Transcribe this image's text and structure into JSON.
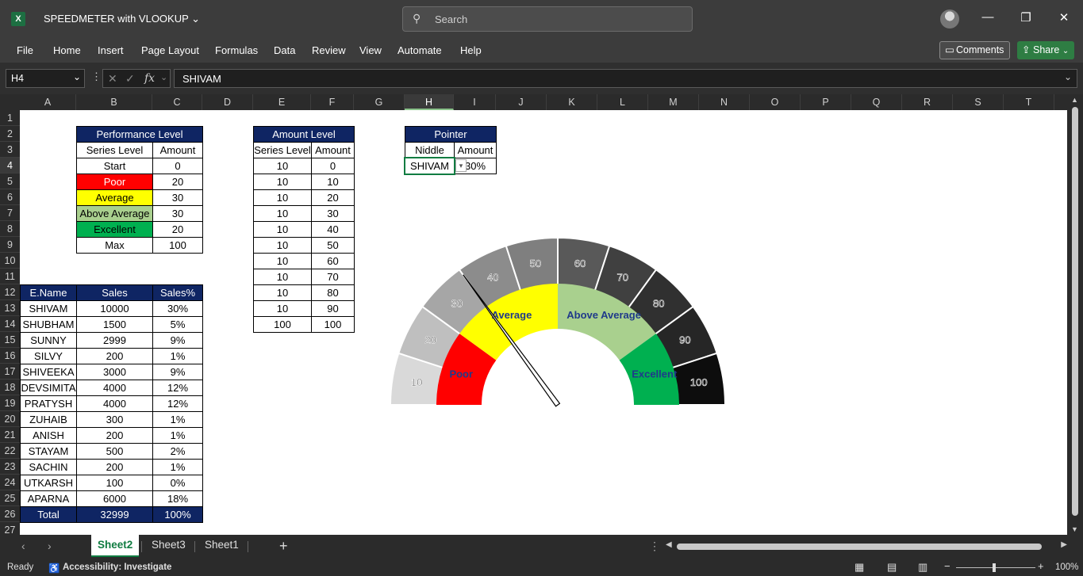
{
  "titlebar": {
    "app_icon": "X",
    "file_title": "SPEEDMETER with VLOOKUP",
    "search_placeholder": "Search"
  },
  "menu": {
    "tabs": [
      "File",
      "Home",
      "Insert",
      "Page Layout",
      "Formulas",
      "Data",
      "Review",
      "View",
      "Automate",
      "Help"
    ],
    "comments_label": "Comments",
    "share_label": "Share"
  },
  "formula_bar": {
    "name_box": "H4",
    "fx_label": "fx",
    "value": "SHIVAM"
  },
  "columns": [
    "A",
    "B",
    "C",
    "D",
    "E",
    "F",
    "G",
    "H",
    "I",
    "J",
    "K",
    "L",
    "M",
    "N",
    "O",
    "P",
    "Q",
    "R",
    "S",
    "T"
  ],
  "rows": [
    "1",
    "2",
    "3",
    "4",
    "5",
    "6",
    "7",
    "8",
    "9",
    "10",
    "11",
    "12",
    "13",
    "14",
    "15",
    "16",
    "17",
    "18",
    "19",
    "20",
    "21",
    "22",
    "23",
    "24",
    "25",
    "26",
    "27"
  ],
  "performance_table": {
    "title": "Performance Level",
    "headers": [
      "Series Level",
      "Amount"
    ],
    "rows": [
      {
        "level": "Start",
        "amount": "0",
        "color": "#ffffff",
        "text_color": "#000000"
      },
      {
        "level": "Poor",
        "amount": "20",
        "color": "#ff0000",
        "text_color": "#ffffff"
      },
      {
        "level": "Average",
        "amount": "30",
        "color": "#ffff00",
        "text_color": "#000000"
      },
      {
        "level": "Above Average",
        "amount": "30",
        "color": "#a9d08e",
        "text_color": "#000000"
      },
      {
        "level": "Excellent",
        "amount": "20",
        "color": "#00b050",
        "text_color": "#000000"
      },
      {
        "level": "Max",
        "amount": "100",
        "color": "#ffffff",
        "text_color": "#000000"
      }
    ]
  },
  "amount_table": {
    "title": "Amount Level",
    "headers": [
      "Series Level",
      "Amount"
    ],
    "rows": [
      [
        "10",
        "0"
      ],
      [
        "10",
        "10"
      ],
      [
        "10",
        "20"
      ],
      [
        "10",
        "30"
      ],
      [
        "10",
        "40"
      ],
      [
        "10",
        "50"
      ],
      [
        "10",
        "60"
      ],
      [
        "10",
        "70"
      ],
      [
        "10",
        "80"
      ],
      [
        "10",
        "90"
      ],
      [
        "100",
        "100"
      ]
    ]
  },
  "pointer_table": {
    "title": "Pointer",
    "headers": [
      "Niddle",
      "Amount"
    ],
    "name": "SHIVAM",
    "amount": "30%"
  },
  "sales_table": {
    "headers": [
      "E.Name",
      "Sales",
      "Sales%"
    ],
    "rows": [
      [
        "SHIVAM",
        "10000",
        "30%"
      ],
      [
        "SHUBHAM",
        "1500",
        "5%"
      ],
      [
        "SUNNY",
        "2999",
        "9%"
      ],
      [
        "SILVY",
        "200",
        "1%"
      ],
      [
        "SHIVEEKA",
        "3000",
        "9%"
      ],
      [
        "DEVSIMITA",
        "4000",
        "12%"
      ],
      [
        "PRATYSH",
        "4000",
        "12%"
      ],
      [
        "ZUHAIB",
        "300",
        "1%"
      ],
      [
        "ANISH",
        "200",
        "1%"
      ],
      [
        "STAYAM",
        "500",
        "2%"
      ],
      [
        "SACHIN",
        "200",
        "1%"
      ],
      [
        "UTKARSH",
        "100",
        "0%"
      ],
      [
        "APARNA",
        "6000",
        "18%"
      ]
    ],
    "total": [
      "Total",
      "32999",
      "100%"
    ]
  },
  "chart_data": {
    "type": "pie",
    "outer_ring": {
      "labels": [
        "10",
        "20",
        "30",
        "40",
        "50",
        "60",
        "70",
        "80",
        "90",
        "100"
      ],
      "values": [
        10,
        10,
        10,
        10,
        10,
        10,
        10,
        10,
        10,
        10
      ],
      "colors": [
        "#d9d9d9",
        "#bfbfbf",
        "#a6a6a6",
        "#8c8c8c",
        "#7f7f7f",
        "#595959",
        "#404040",
        "#303030",
        "#262626",
        "#0d0d0d"
      ]
    },
    "inner_ring": {
      "labels": [
        "Poor",
        "Average",
        "Above Average",
        "Excellent"
      ],
      "values": [
        20,
        30,
        30,
        20
      ],
      "colors": [
        "#ff0000",
        "#ffff00",
        "#a9d08e",
        "#00b050"
      ]
    },
    "pointer_value_percent": 30
  },
  "sheet_tabs": [
    "Sheet2",
    "Sheet3",
    "Sheet1"
  ],
  "active_sheet": "Sheet2",
  "status": {
    "ready": "Ready",
    "accessibility": "Accessibility: Investigate",
    "zoom": "100%"
  }
}
